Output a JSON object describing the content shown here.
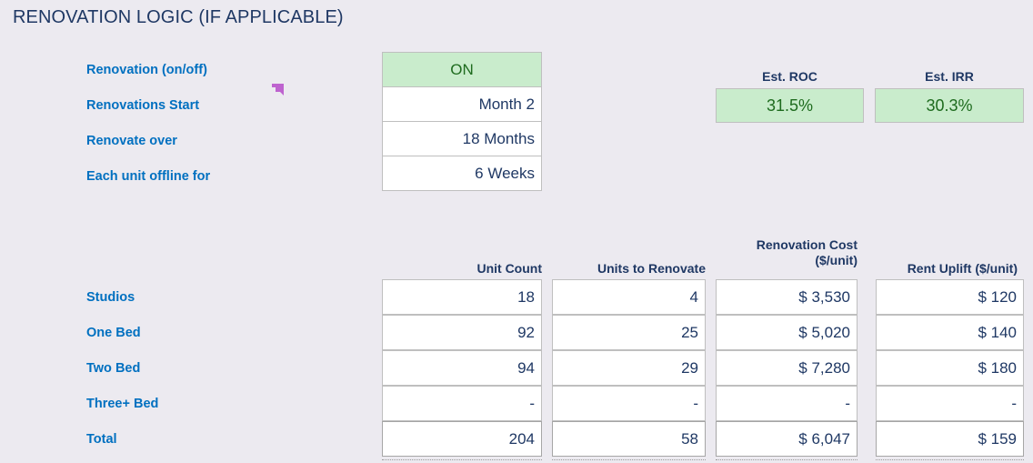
{
  "section": {
    "title": "RENOVATION LOGIC (IF APPLICABLE)"
  },
  "settings": {
    "rows": [
      {
        "label": "Renovation (on/off)",
        "value": "ON",
        "state": "on"
      },
      {
        "label": "Renovations Start",
        "value": "Month 2",
        "state": "normal"
      },
      {
        "label": "Renovate over",
        "value": "18 Months",
        "state": "normal"
      },
      {
        "label": "Each unit offline for",
        "value": "6 Weeks",
        "state": "normal"
      }
    ]
  },
  "kpis": [
    {
      "label": "Est. ROC",
      "value": "31.5%"
    },
    {
      "label": "Est. IRR",
      "value": "30.3%"
    }
  ],
  "unit_table": {
    "columns": [
      {
        "key": "unit_count",
        "header": "Unit Count"
      },
      {
        "key": "units_to_renovate",
        "header": "Units to Renovate"
      },
      {
        "key": "renovation_cost",
        "header": "Renovation Cost\n($/unit)"
      },
      {
        "key": "rent_uplift",
        "header": "Rent Uplift ($/unit)"
      }
    ],
    "rows": [
      {
        "label": "Studios",
        "unit_count": "18",
        "units_to_renovate": "4",
        "renovation_cost": "$ 3,530",
        "rent_uplift": "$ 120",
        "is_total": false
      },
      {
        "label": "One Bed",
        "unit_count": "92",
        "units_to_renovate": "25",
        "renovation_cost": "$ 5,020",
        "rent_uplift": "$ 140",
        "is_total": false
      },
      {
        "label": "Two Bed",
        "unit_count": "94",
        "units_to_renovate": "29",
        "renovation_cost": "$ 7,280",
        "rent_uplift": "$ 180",
        "is_total": false
      },
      {
        "label": "Three+ Bed",
        "unit_count": "-",
        "units_to_renovate": "-",
        "renovation_cost": "-",
        "rent_uplift": "-",
        "is_total": false
      },
      {
        "label": "Total",
        "unit_count": "204",
        "units_to_renovate": "58",
        "renovation_cost": "$ 6,047",
        "rent_uplift": "$ 159",
        "is_total": true
      }
    ]
  },
  "cursor": {
    "name": "cell-selection-marker",
    "color": "#BE63CF"
  },
  "colors": {
    "background": "#ECEAF0",
    "label_blue": "#0070C0",
    "header_navy": "#1F3864",
    "highlight_green_fill": "#C9ECCC",
    "highlight_green_text": "#1E6B1E",
    "cell_border": "#BFBFBF"
  }
}
